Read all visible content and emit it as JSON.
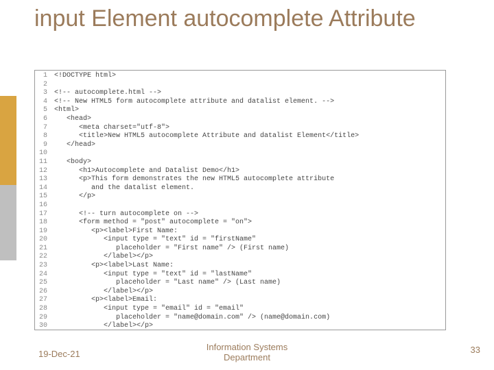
{
  "title": "input Element autocomplete Attribute",
  "footer": {
    "date": "19-Dec-21",
    "dept_line1": "Information Systems",
    "dept_line2": "Department",
    "page": "33"
  },
  "code": [
    {
      "n": "1",
      "t": "<!DOCTYPE html>"
    },
    {
      "n": "2",
      "t": ""
    },
    {
      "n": "3",
      "t": "<!-- autocomplete.html -->"
    },
    {
      "n": "4",
      "t": "<!-- New HTML5 form autocomplete attribute and datalist element. -->"
    },
    {
      "n": "5",
      "t": "<html>"
    },
    {
      "n": "6",
      "t": "   <head>"
    },
    {
      "n": "7",
      "t": "      <meta charset=\"utf-8\">"
    },
    {
      "n": "8",
      "t": "      <title>New HTML5 autocomplete Attribute and datalist Element</title>"
    },
    {
      "n": "9",
      "t": "   </head>"
    },
    {
      "n": "10",
      "t": ""
    },
    {
      "n": "11",
      "t": "   <body>"
    },
    {
      "n": "12",
      "t": "      <h1>Autocomplete and Datalist Demo</h1>"
    },
    {
      "n": "13",
      "t": "      <p>This form demonstrates the new HTML5 autocomplete attribute"
    },
    {
      "n": "14",
      "t": "         and the datalist element."
    },
    {
      "n": "15",
      "t": "      </p>"
    },
    {
      "n": "16",
      "t": ""
    },
    {
      "n": "17",
      "t": "      <!-- turn autocomplete on -->"
    },
    {
      "n": "18",
      "t": "      <form method = \"post\" autocomplete = \"on\">"
    },
    {
      "n": "19",
      "t": "         <p><label>First Name:"
    },
    {
      "n": "20",
      "t": "            <input type = \"text\" id = \"firstName\""
    },
    {
      "n": "21",
      "t": "               placeholder = \"First name\" /> (First name)"
    },
    {
      "n": "22",
      "t": "            </label></p>"
    },
    {
      "n": "23",
      "t": "         <p><label>Last Name:"
    },
    {
      "n": "24",
      "t": "            <input type = \"text\" id = \"lastName\""
    },
    {
      "n": "25",
      "t": "               placeholder = \"Last name\" /> (Last name)"
    },
    {
      "n": "26",
      "t": "            </label></p>"
    },
    {
      "n": "27",
      "t": "         <p><label>Email:"
    },
    {
      "n": "28",
      "t": "            <input type = \"email\" id = \"email\""
    },
    {
      "n": "29",
      "t": "               placeholder = \"name@domain.com\" /> (name@domain.com)"
    },
    {
      "n": "30",
      "t": "            </label></p>"
    }
  ]
}
